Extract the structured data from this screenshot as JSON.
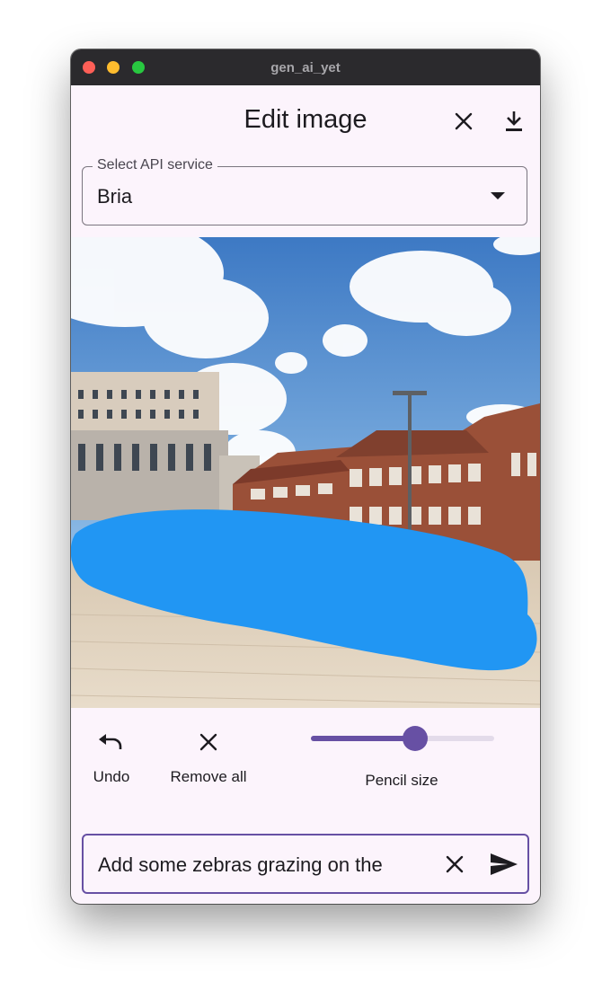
{
  "window": {
    "title": "gen_ai_yet"
  },
  "appbar": {
    "title": "Edit image",
    "close_icon": "close-icon",
    "download_icon": "download-icon"
  },
  "api_select": {
    "label": "Select API service",
    "value": "Bria"
  },
  "canvas": {
    "mask_color": "#2196f3",
    "description_icon": "photo-with-mask"
  },
  "tools": {
    "undo_label": "Undo",
    "remove_all_label": "Remove all",
    "pencil_size_label": "Pencil size",
    "pencil_size_fraction": 0.57
  },
  "prompt": {
    "value": "Add some zebras grazing on the",
    "clear_icon": "close-icon",
    "send_icon": "send-icon"
  },
  "colors": {
    "accent": "#6750a4",
    "surface": "#fcf4fc",
    "titlebar": "#2b2a2d"
  }
}
